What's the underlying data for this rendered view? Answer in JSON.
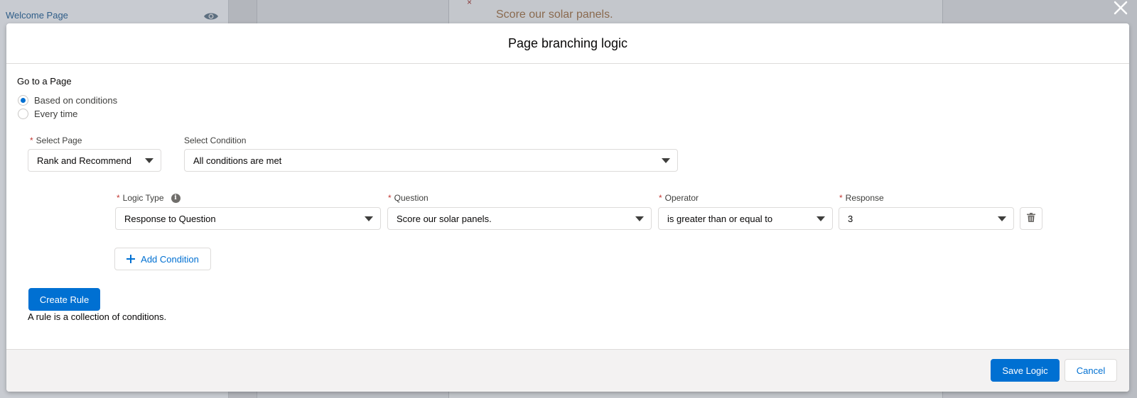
{
  "background": {
    "nav_link": "Welcome Page",
    "question_preview": "Score our solar panels.",
    "small_x": "×"
  },
  "modal": {
    "title": "Page branching logic",
    "go_to_label": "Go to a Page",
    "radio_options": [
      {
        "label": "Based on conditions",
        "checked": true
      },
      {
        "label": "Every time",
        "checked": false
      }
    ],
    "select_page": {
      "label": "Select Page",
      "required": "*",
      "value": "Rank and Recommend"
    },
    "select_condition": {
      "label": "Select Condition",
      "value": "All conditions are met"
    },
    "condition_row": {
      "logic_type": {
        "label": "Logic Type",
        "required": "*",
        "value": "Response to Question",
        "info_glyph": "i"
      },
      "question": {
        "label": "Question",
        "required": "*",
        "value": "Score our solar panels."
      },
      "operator": {
        "label": "Operator",
        "required": "*",
        "value": "is greater than or equal to"
      },
      "response": {
        "label": "Response",
        "required": "*",
        "value": "3"
      }
    },
    "add_condition_label": "Add Condition",
    "create_rule_label": "Create Rule",
    "rule_help_text": "A rule is a collection of conditions.",
    "footer": {
      "save_label": "Save Logic",
      "cancel_label": "Cancel"
    }
  },
  "colors": {
    "brand": "#0070d2",
    "required": "#c23934",
    "border": "#dddbda"
  }
}
